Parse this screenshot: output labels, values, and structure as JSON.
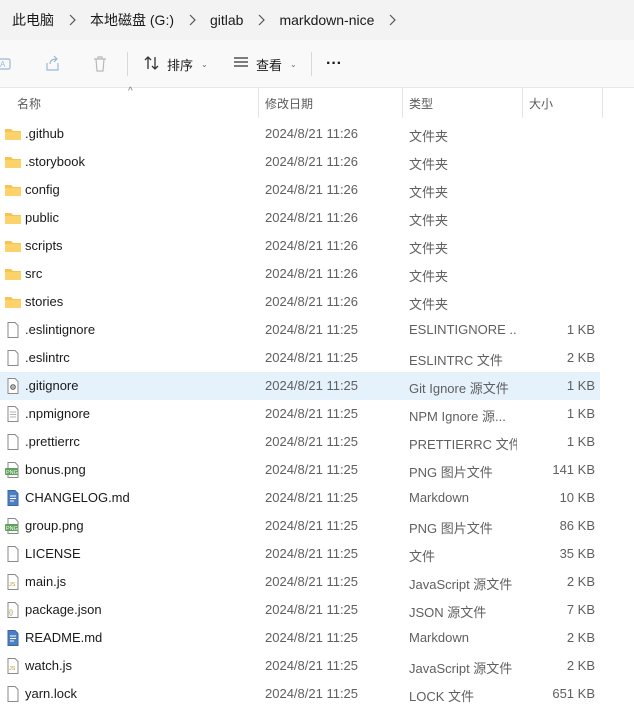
{
  "breadcrumb": [
    "此电脑",
    "本地磁盘 (G:)",
    "gitlab",
    "markdown-nice"
  ],
  "toolbar": {
    "sort_label": "排序",
    "view_label": "查看",
    "more_label": "···"
  },
  "columns": {
    "name": "名称",
    "modified": "修改日期",
    "type": "类型",
    "size": "大小"
  },
  "files": [
    {
      "name": ".github",
      "modified": "2024/8/21 11:26",
      "type": "文件夹",
      "size": "",
      "icon": "folder-icon"
    },
    {
      "name": ".storybook",
      "modified": "2024/8/21 11:26",
      "type": "文件夹",
      "size": "",
      "icon": "folder-icon"
    },
    {
      "name": "config",
      "modified": "2024/8/21 11:26",
      "type": "文件夹",
      "size": "",
      "icon": "folder-icon"
    },
    {
      "name": "public",
      "modified": "2024/8/21 11:26",
      "type": "文件夹",
      "size": "",
      "icon": "folder-icon"
    },
    {
      "name": "scripts",
      "modified": "2024/8/21 11:26",
      "type": "文件夹",
      "size": "",
      "icon": "folder-icon"
    },
    {
      "name": "src",
      "modified": "2024/8/21 11:26",
      "type": "文件夹",
      "size": "",
      "icon": "folder-icon"
    },
    {
      "name": "stories",
      "modified": "2024/8/21 11:26",
      "type": "文件夹",
      "size": "",
      "icon": "folder-icon"
    },
    {
      "name": ".eslintignore",
      "modified": "2024/8/21 11:25",
      "type": "ESLINTIGNORE ...",
      "size": "1 KB",
      "icon": "file-icon"
    },
    {
      "name": ".eslintrc",
      "modified": "2024/8/21 11:25",
      "type": "ESLINTRC 文件",
      "size": "2 KB",
      "icon": "file-icon"
    },
    {
      "name": ".gitignore",
      "modified": "2024/8/21 11:25",
      "type": "Git Ignore 源文件",
      "size": "1 KB",
      "icon": "settings-file-icon",
      "selected": true
    },
    {
      "name": ".npmignore",
      "modified": "2024/8/21 11:25",
      "type": "NPM Ignore 源...",
      "size": "1 KB",
      "icon": "text-file-icon"
    },
    {
      "name": ".prettierrc",
      "modified": "2024/8/21 11:25",
      "type": "PRETTIERRC 文件",
      "size": "1 KB",
      "icon": "file-icon"
    },
    {
      "name": "bonus.png",
      "modified": "2024/8/21 11:25",
      "type": "PNG 图片文件",
      "size": "141 KB",
      "icon": "image-file-icon"
    },
    {
      "name": "CHANGELOG.md",
      "modified": "2024/8/21 11:25",
      "type": "Markdown",
      "size": "10 KB",
      "icon": "markdown-file-icon"
    },
    {
      "name": "group.png",
      "modified": "2024/8/21 11:25",
      "type": "PNG 图片文件",
      "size": "86 KB",
      "icon": "image-file-icon"
    },
    {
      "name": "LICENSE",
      "modified": "2024/8/21 11:25",
      "type": "文件",
      "size": "35 KB",
      "icon": "file-icon"
    },
    {
      "name": "main.js",
      "modified": "2024/8/21 11:25",
      "type": "JavaScript 源文件",
      "size": "2 KB",
      "icon": "js-file-icon"
    },
    {
      "name": "package.json",
      "modified": "2024/8/21 11:25",
      "type": "JSON 源文件",
      "size": "7 KB",
      "icon": "json-file-icon"
    },
    {
      "name": "README.md",
      "modified": "2024/8/21 11:25",
      "type": "Markdown",
      "size": "2 KB",
      "icon": "markdown-file-icon"
    },
    {
      "name": "watch.js",
      "modified": "2024/8/21 11:25",
      "type": "JavaScript 源文件",
      "size": "2 KB",
      "icon": "js-file-icon"
    },
    {
      "name": "yarn.lock",
      "modified": "2024/8/21 11:25",
      "type": "LOCK 文件",
      "size": "651 KB",
      "icon": "file-icon"
    }
  ],
  "colors": {
    "selection": "#e5f1fb",
    "folder": "#f8c44f",
    "accent": "#0067c0"
  }
}
